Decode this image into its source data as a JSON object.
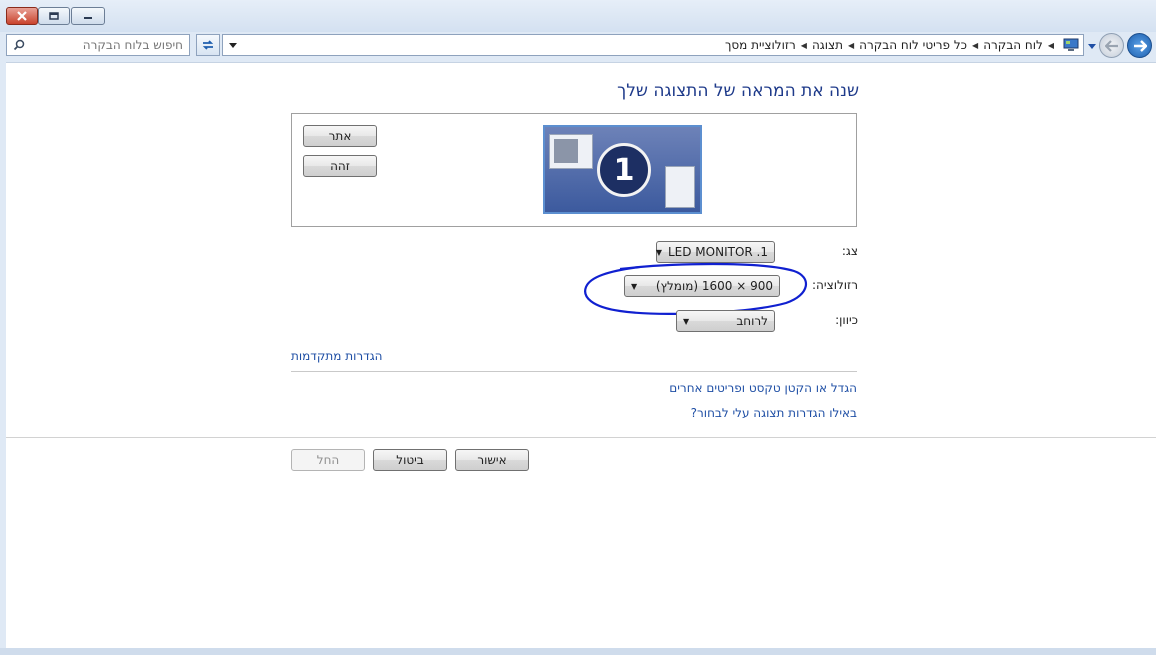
{
  "window": {
    "colors": {
      "accent": "#1e3a8a",
      "link": "#1f4fa5",
      "close": "#c9432d"
    }
  },
  "nav": {
    "search_placeholder": "חיפוש בלוח הבקרה",
    "breadcrumbs": [
      "לוח הבקרה",
      "כל פריטי לוח הבקרה",
      "תצוגה",
      "רזולוציית מסך"
    ],
    "icons": [
      "search-icon",
      "refresh-icon",
      "dropdown-arrow-icon",
      "control-panel-icon",
      "history-arrow-icon",
      "forward-arrow-icon",
      "back-arrow-icon"
    ]
  },
  "main": {
    "title": "שנה את המראה של התצוגה שלך",
    "detect_label": "אתר",
    "identify_label": "זהה",
    "monitor_number": "1",
    "display_label": "צג:",
    "display_value": "LED MONITOR .1",
    "resolution_label": "רזולוציה:",
    "resolution_value": "900 × 1600 (מומלץ)",
    "orientation_label": "כיוון:",
    "orientation_value": "לרוחב",
    "advanced_link": "הגדרות מתקדמות",
    "text_size_link": "הגדל או הקטן טקסט ופריטים אחרים",
    "which_settings_link": "באילו הגדרות תצוגה עלי לבחור?"
  },
  "footer": {
    "ok_label": "אישור",
    "cancel_label": "ביטול",
    "apply_label": "החל"
  }
}
